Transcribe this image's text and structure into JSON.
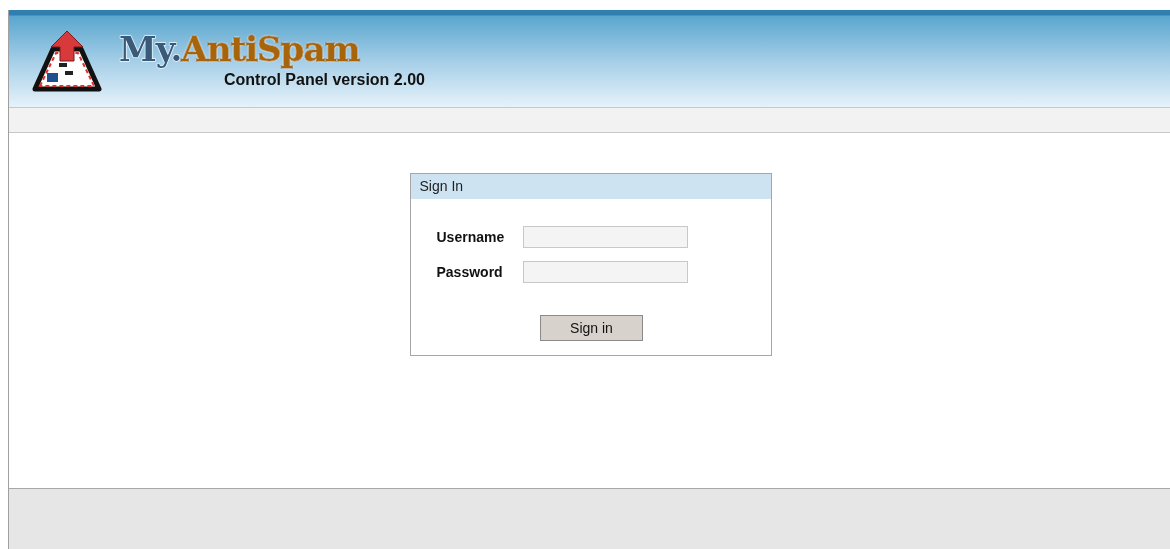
{
  "header": {
    "logo_text": [
      "My.",
      "AntiSpam"
    ],
    "subtitle": "Control Panel version 2.00"
  },
  "sign_in": {
    "title": "Sign In",
    "fields": [
      {
        "label": "Username"
      },
      {
        "label": "Password"
      }
    ],
    "button": "Sign in"
  }
}
